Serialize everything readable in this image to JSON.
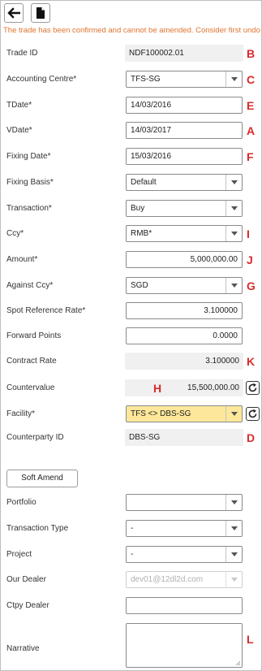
{
  "warning": "The trade has been confirmed and cannot be amended. Consider first undo",
  "toolbar": {
    "back_icon": "arrow-left-icon",
    "doc_icon": "document-icon"
  },
  "accent_color": "#e0732f",
  "marker_color": "#d92b2b",
  "fields": {
    "trade_id": {
      "label": "Trade ID",
      "value": "NDF100002.01",
      "marker": "B"
    },
    "accounting_centre": {
      "label": "Accounting Centre*",
      "value": "TFS-SG",
      "marker": "C"
    },
    "tdate": {
      "label": "TDate*",
      "value": "14/03/2016",
      "marker": "E"
    },
    "vdate": {
      "label": "VDate*",
      "value": "14/03/2017",
      "marker": "A"
    },
    "fixing_date": {
      "label": "Fixing Date*",
      "value": "15/03/2016",
      "marker": "F"
    },
    "fixing_basis": {
      "label": "Fixing Basis*",
      "value": "Default"
    },
    "transaction": {
      "label": "Transaction*",
      "value": "Buy"
    },
    "ccy": {
      "label": "Ccy*",
      "value": "RMB*",
      "marker": "I"
    },
    "amount": {
      "label": "Amount*",
      "value": "5,000,000.00",
      "marker": "J"
    },
    "against_ccy": {
      "label": "Against Ccy*",
      "value": "SGD",
      "marker": "G"
    },
    "spot_rate": {
      "label": "Spot Reference Rate*",
      "value": "3.100000"
    },
    "forward_points": {
      "label": "Forward Points",
      "value": "0.0000"
    },
    "contract_rate": {
      "label": "Contract Rate",
      "value": "3.100000",
      "marker": "K"
    },
    "countervalue": {
      "label": "Countervalue",
      "value": "15,500,000.00",
      "marker": "H"
    },
    "facility": {
      "label": "Facility*",
      "value": "TFS <> DBS-SG"
    },
    "counterparty_id": {
      "label": "Counterparty ID",
      "value": "DBS-SG",
      "marker": "D"
    }
  },
  "soft_amend_label": "Soft Amend",
  "lower": {
    "portfolio": {
      "label": "Portfolio",
      "value": ""
    },
    "transaction_type": {
      "label": "Transaction Type",
      "value": "-"
    },
    "project": {
      "label": "Project",
      "value": "-"
    },
    "our_dealer": {
      "label": "Our Dealer",
      "value": "dev01@12dl2d.com"
    },
    "ctpy_dealer": {
      "label": "Ctpy Dealer",
      "value": ""
    },
    "narrative": {
      "label": "Narrative",
      "value": "",
      "marker": "L"
    }
  }
}
